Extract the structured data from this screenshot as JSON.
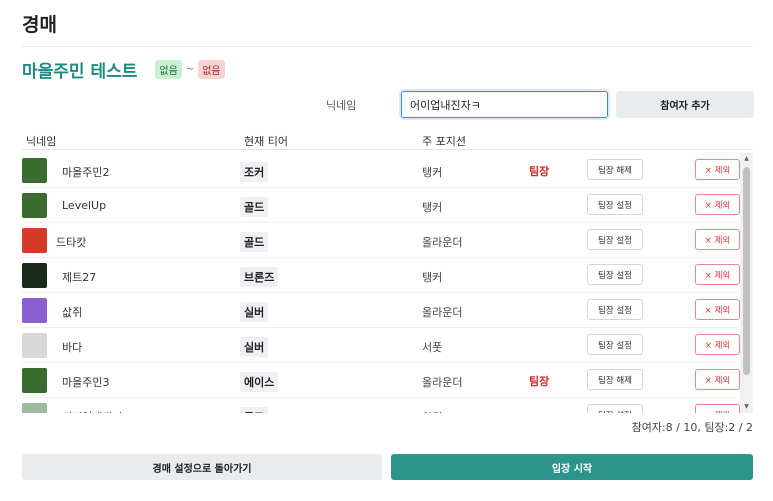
{
  "page": {
    "title": "경매"
  },
  "auction": {
    "name": "마을주민 테스트",
    "start_badge": "없음",
    "separator": "~",
    "end_badge": "없음"
  },
  "add_form": {
    "nickname_label": "닉네임",
    "nickname_value": "어이업내진자ㅋ",
    "add_button": "참여자 추가"
  },
  "table": {
    "headers": {
      "nickname": "닉네임",
      "tier": "현재 티어",
      "position": "주 포지션"
    },
    "rows": [
      {
        "nickname": "마을주민2",
        "tier": "조커",
        "position": "탱커",
        "leader": "팀장",
        "leader_button": "팀장 해제",
        "remove_button": "× 제외",
        "avatar": "frog-avatar",
        "avatar_color": "#3a6b2f"
      },
      {
        "nickname": "LevelUp",
        "tier": "골드",
        "position": "탱커",
        "leader": "",
        "leader_button": "팀장 설정",
        "remove_button": "× 제외",
        "avatar": "frog-avatar",
        "avatar_color": "#3a6b2f"
      },
      {
        "nickname": "드타캇",
        "tier": "골드",
        "position": "올라운더",
        "leader": "",
        "leader_button": "팀장 설정",
        "remove_button": "× 제외",
        "avatar": "person-avatar",
        "avatar_color": "#d33a2a"
      },
      {
        "nickname": "제트27",
        "tier": "브론즈",
        "position": "탱커",
        "leader": "",
        "leader_button": "팀장 설정",
        "remove_button": "× 제외",
        "avatar": "dark-avatar",
        "avatar_color": "#1c2a1c"
      },
      {
        "nickname": "삾쥐",
        "tier": "실버",
        "position": "올라운더",
        "leader": "",
        "leader_button": "팀장 설정",
        "remove_button": "× 제외",
        "avatar": "purple-avatar",
        "avatar_color": "#8a5fd0"
      },
      {
        "nickname": "바다",
        "tier": "실버",
        "position": "서폿",
        "leader": "",
        "leader_button": "팀장 설정",
        "remove_button": "× 제외",
        "avatar": "light-avatar",
        "avatar_color": "#d8d8d8"
      },
      {
        "nickname": "마을주민3",
        "tier": "에이스",
        "position": "올라운더",
        "leader": "팀장",
        "leader_button": "팀장 해제",
        "remove_button": "× 제외",
        "avatar": "frog-avatar",
        "avatar_color": "#3a6b2f"
      },
      {
        "nickname": "어이업내진자",
        "tier": "골드",
        "position": "원딜",
        "leader": "",
        "leader_button": "팀장 설정",
        "remove_button": "× 제외",
        "avatar": "sprite-avatar",
        "avatar_color": "#9fb8a0"
      }
    ]
  },
  "summary": "참여자:8 / 10, 팀장:2 / 2",
  "footer": {
    "back_button": "경매 설정으로 돌아가기",
    "start_button": "입장 시작"
  },
  "colors": {
    "accent": "#2d948b",
    "leader": "#d22a2a",
    "remove": "#d33333"
  }
}
